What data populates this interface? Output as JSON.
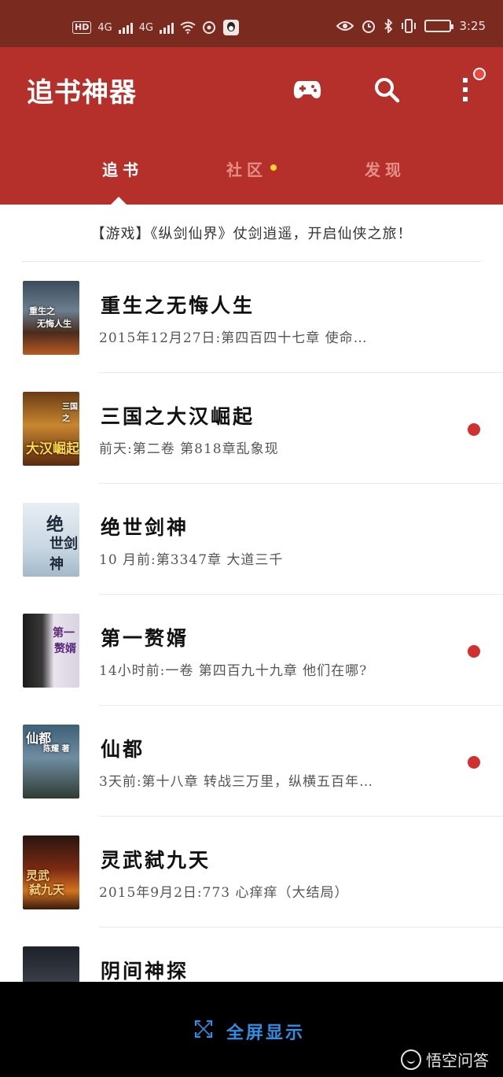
{
  "status_bar": {
    "left": {
      "hd": "HD",
      "sim1": "4G",
      "sim2": "4G"
    },
    "time": "3:25"
  },
  "app": {
    "title": "追书神器",
    "icons": [
      "gamepad-icon",
      "search-icon",
      "more-vertical-icon"
    ],
    "colors": {
      "primary": "#b5302a",
      "status_bar": "#7b2a20",
      "badge": "#e84a40",
      "unread_dot": "#d32f2f",
      "tab_dot": "#ffd233",
      "accent_blue": "#2f8ee5"
    }
  },
  "tabs": [
    {
      "label": "追书",
      "active": true
    },
    {
      "label": "社区",
      "active": false,
      "has_dot": true
    },
    {
      "label": "发现",
      "active": false
    }
  ],
  "banner": {
    "text": "【游戏】《纵剑仙界》仗剑逍遥，开启仙侠之旅！"
  },
  "books": [
    {
      "title": "重生之无悔人生",
      "update": "2015年12月27日:第四百四十七章  使命…",
      "unread": false
    },
    {
      "title": "三国之大汉崛起",
      "update": "前天:第二卷  第818章乱象现",
      "unread": true
    },
    {
      "title": "绝世剑神",
      "update": "10 月前:第3347章     大道三千",
      "unread": false
    },
    {
      "title": "第一赘婿",
      "update": "14小时前:一卷  第四百九十九章  他们在哪?",
      "unread": true
    },
    {
      "title": "仙都",
      "update": "3天前:第十八章  转战三万里，纵横五百年…",
      "unread": true
    },
    {
      "title": "灵武弑九天",
      "update": "2015年9月2日:773  心痒痒（大结局）",
      "unread": false
    },
    {
      "title": "阴间神探",
      "update": "",
      "unread": false
    }
  ],
  "bottom_bar": {
    "fullscreen_label": "全屏显示",
    "watermark": "悟空问答"
  }
}
